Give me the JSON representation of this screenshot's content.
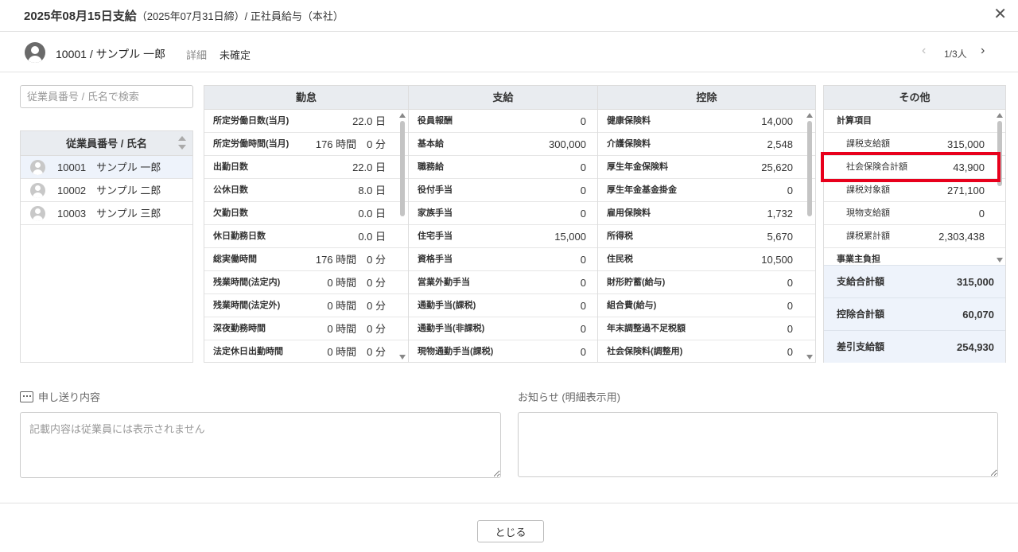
{
  "header": {
    "title": "2025年08月15日支給",
    "subtitle": "（2025年07月31日締）/ 正社員給与（本社）",
    "close_glyph": "✕"
  },
  "employee_bar": {
    "name": "10001 / サンプル 一郎",
    "detail_link": "詳細",
    "status": "未確定",
    "pager": "1/3人",
    "prev_glyph": "‹",
    "next_glyph": "›"
  },
  "employee_list": {
    "search_placeholder": "従業員番号 / 氏名で検索",
    "header": "従業員番号 / 氏名",
    "rows": [
      {
        "text": "10001　サンプル 一郎"
      },
      {
        "text": "10002　サンプル 二郎"
      },
      {
        "text": "10003　サンプル 三郎"
      }
    ]
  },
  "attendance": {
    "title": "勤怠",
    "rows": [
      {
        "label": "所定労働日数(当月)",
        "value": "22.0 日"
      },
      {
        "label": "所定労働時間(当月)",
        "value": "176 時間　0 分"
      },
      {
        "label": "出勤日数",
        "value": "22.0 日"
      },
      {
        "label": "公休日数",
        "value": "8.0 日"
      },
      {
        "label": "欠勤日数",
        "value": "0.0 日"
      },
      {
        "label": "休日勤務日数",
        "value": "0.0 日"
      },
      {
        "label": "総実働時間",
        "value": "176 時間　0 分"
      },
      {
        "label": "残業時間(法定内)",
        "value": "0 時間　0 分"
      },
      {
        "label": "残業時間(法定外)",
        "value": "0 時間　0 分"
      },
      {
        "label": "深夜勤務時間",
        "value": "0 時間　0 分"
      },
      {
        "label": "法定休日出勤時間",
        "value": "0 時間　0 分"
      }
    ]
  },
  "payment": {
    "title": "支給",
    "rows": [
      {
        "label": "役員報酬",
        "value": "0"
      },
      {
        "label": "基本給",
        "value": "300,000"
      },
      {
        "label": "職務給",
        "value": "0"
      },
      {
        "label": "役付手当",
        "value": "0"
      },
      {
        "label": "家族手当",
        "value": "0"
      },
      {
        "label": "住宅手当",
        "value": "15,000"
      },
      {
        "label": "資格手当",
        "value": "0"
      },
      {
        "label": "営業外勤手当",
        "value": "0"
      },
      {
        "label": "通勤手当(課税)",
        "value": "0"
      },
      {
        "label": "通勤手当(非課税)",
        "value": "0"
      },
      {
        "label": "現物通勤手当(課税)",
        "value": "0"
      }
    ]
  },
  "deduction": {
    "title": "控除",
    "rows": [
      {
        "label": "健康保険料",
        "value": "14,000"
      },
      {
        "label": "介護保険料",
        "value": "2,548"
      },
      {
        "label": "厚生年金保険料",
        "value": "25,620"
      },
      {
        "label": "厚生年金基金掛金",
        "value": "0"
      },
      {
        "label": "雇用保険料",
        "value": "1,732"
      },
      {
        "label": "所得税",
        "value": "5,670"
      },
      {
        "label": "住民税",
        "value": "10,500"
      },
      {
        "label": "財形貯蓄(給与)",
        "value": "0"
      },
      {
        "label": "組合費(給与)",
        "value": "0"
      },
      {
        "label": "年末調整過不足税額",
        "value": "0"
      },
      {
        "label": "社会保険料(調整用)",
        "value": "0"
      }
    ]
  },
  "other": {
    "title": "その他",
    "section1": "計算項目",
    "rows": [
      {
        "label": "課税支給額",
        "value": "315,000"
      },
      {
        "label": "社会保険合計額",
        "value": "43,900"
      },
      {
        "label": "課税対象額",
        "value": "271,100"
      },
      {
        "label": "現物支給額",
        "value": "0"
      },
      {
        "label": "課税累計額",
        "value": "2,303,438"
      }
    ],
    "section2": "事業主負担",
    "totals": [
      {
        "label": "支給合計額",
        "value": "315,000"
      },
      {
        "label": "控除合計額",
        "value": "60,070"
      },
      {
        "label": "差引支給額",
        "value": "254,930"
      }
    ],
    "highlight_color": "#e8001c"
  },
  "memo": {
    "label": "申し送り内容",
    "placeholder": "記載内容は従業員には表示されません",
    "notice_label": "お知らせ (明細表示用)",
    "notice_value": ""
  },
  "footer": {
    "close_button": "とじる"
  }
}
